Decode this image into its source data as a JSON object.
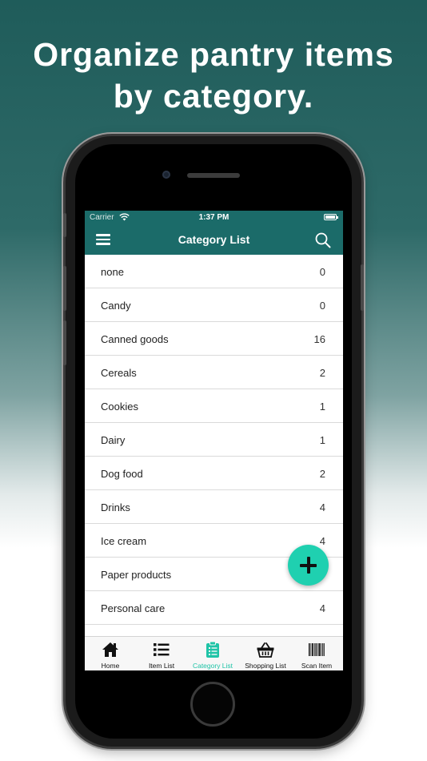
{
  "headline": {
    "line1": "Organize pantry items",
    "line2": "by category."
  },
  "status_bar": {
    "carrier": "Carrier",
    "time": "1:37 PM"
  },
  "nav": {
    "title": "Category List"
  },
  "categories": [
    {
      "name": "none",
      "count": "0"
    },
    {
      "name": "Candy",
      "count": "0"
    },
    {
      "name": "Canned goods",
      "count": "16"
    },
    {
      "name": "Cereals",
      "count": "2"
    },
    {
      "name": "Cookies",
      "count": "1"
    },
    {
      "name": "Dairy",
      "count": "1"
    },
    {
      "name": "Dog food",
      "count": "2"
    },
    {
      "name": "Drinks",
      "count": "4"
    },
    {
      "name": "Ice cream",
      "count": "4"
    },
    {
      "name": "Paper products",
      "count": ""
    },
    {
      "name": "Personal care",
      "count": "4"
    },
    {
      "name": "",
      "count": ""
    }
  ],
  "tabs": [
    {
      "label": "Home",
      "icon": "home-icon"
    },
    {
      "label": "Item List",
      "icon": "list-icon"
    },
    {
      "label": "Category List",
      "icon": "clipboard-icon",
      "active": true
    },
    {
      "label": "Shopping List",
      "icon": "basket-icon"
    },
    {
      "label": "Scan Item",
      "icon": "barcode-icon"
    }
  ],
  "colors": {
    "header": "#1b6b69",
    "accent": "#1fd0b0",
    "background_top": "#1f5c5a"
  },
  "fab": {
    "icon": "plus-icon"
  }
}
